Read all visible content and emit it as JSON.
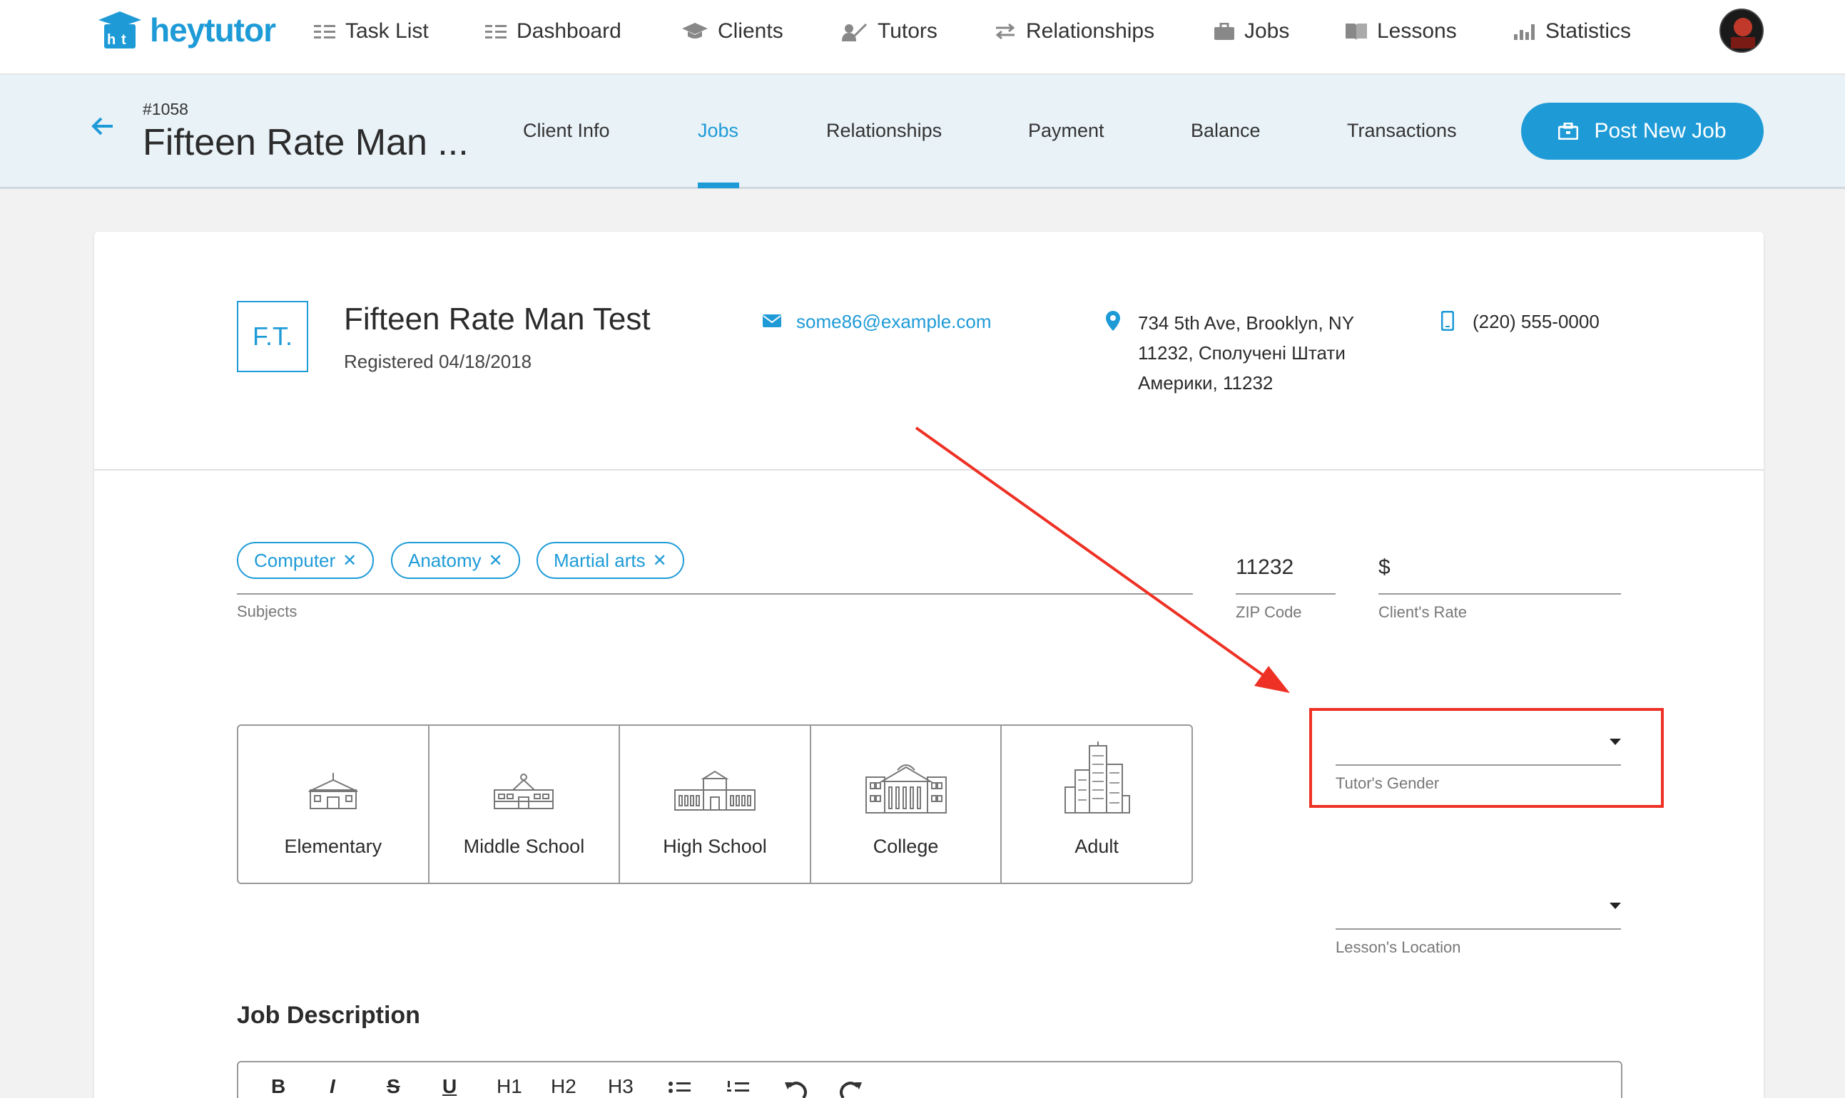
{
  "brand": {
    "name": "heytutor",
    "color": "#1e9bd7"
  },
  "nav": {
    "items": [
      {
        "label": "Task List",
        "icon": "list-icon"
      },
      {
        "label": "Dashboard",
        "icon": "list-icon"
      },
      {
        "label": "Clients",
        "icon": "graduation-cap-icon"
      },
      {
        "label": "Tutors",
        "icon": "teacher-icon"
      },
      {
        "label": "Relationships",
        "icon": "arrows-swap-icon"
      },
      {
        "label": "Jobs",
        "icon": "briefcase-icon"
      },
      {
        "label": "Lessons",
        "icon": "book-icon"
      },
      {
        "label": "Statistics",
        "icon": "bar-chart-icon"
      }
    ]
  },
  "subheader": {
    "job_id": "#1058",
    "title": "Fifteen Rate Man ...",
    "tabs": [
      {
        "label": "Client Info",
        "active": false
      },
      {
        "label": "Jobs",
        "active": true
      },
      {
        "label": "Relationships",
        "active": false
      },
      {
        "label": "Payment",
        "active": false
      },
      {
        "label": "Balance",
        "active": false
      },
      {
        "label": "Transactions",
        "active": false
      }
    ],
    "post_button": "Post New Job"
  },
  "client": {
    "initials": "F.T.",
    "name": "Fifteen Rate Man Test",
    "registered": "Registered 04/18/2018",
    "email": "some86@example.com",
    "address_lines": [
      "734 5th Ave, Brooklyn, NY",
      "11232, Сполучені Штати",
      "Америки, 11232"
    ],
    "phone": "(220) 555-0000"
  },
  "form": {
    "subjects": [
      "Computer",
      "Anatomy",
      "Martial arts"
    ],
    "subjects_label": "Subjects",
    "zip_value": "11232",
    "zip_label": "ZIP Code",
    "rate_prefix": "$",
    "rate_label": "Client's Rate",
    "levels": [
      "Elementary",
      "Middle School",
      "High School",
      "College",
      "Adult"
    ],
    "gender_label": "Tutor's Gender",
    "location_label": "Lesson's Location",
    "job_description_label": "Job Description",
    "toolbar": [
      "B",
      "I",
      "S",
      "U",
      "H1",
      "H2",
      "H3"
    ]
  },
  "annotation_color": "#ee3124"
}
